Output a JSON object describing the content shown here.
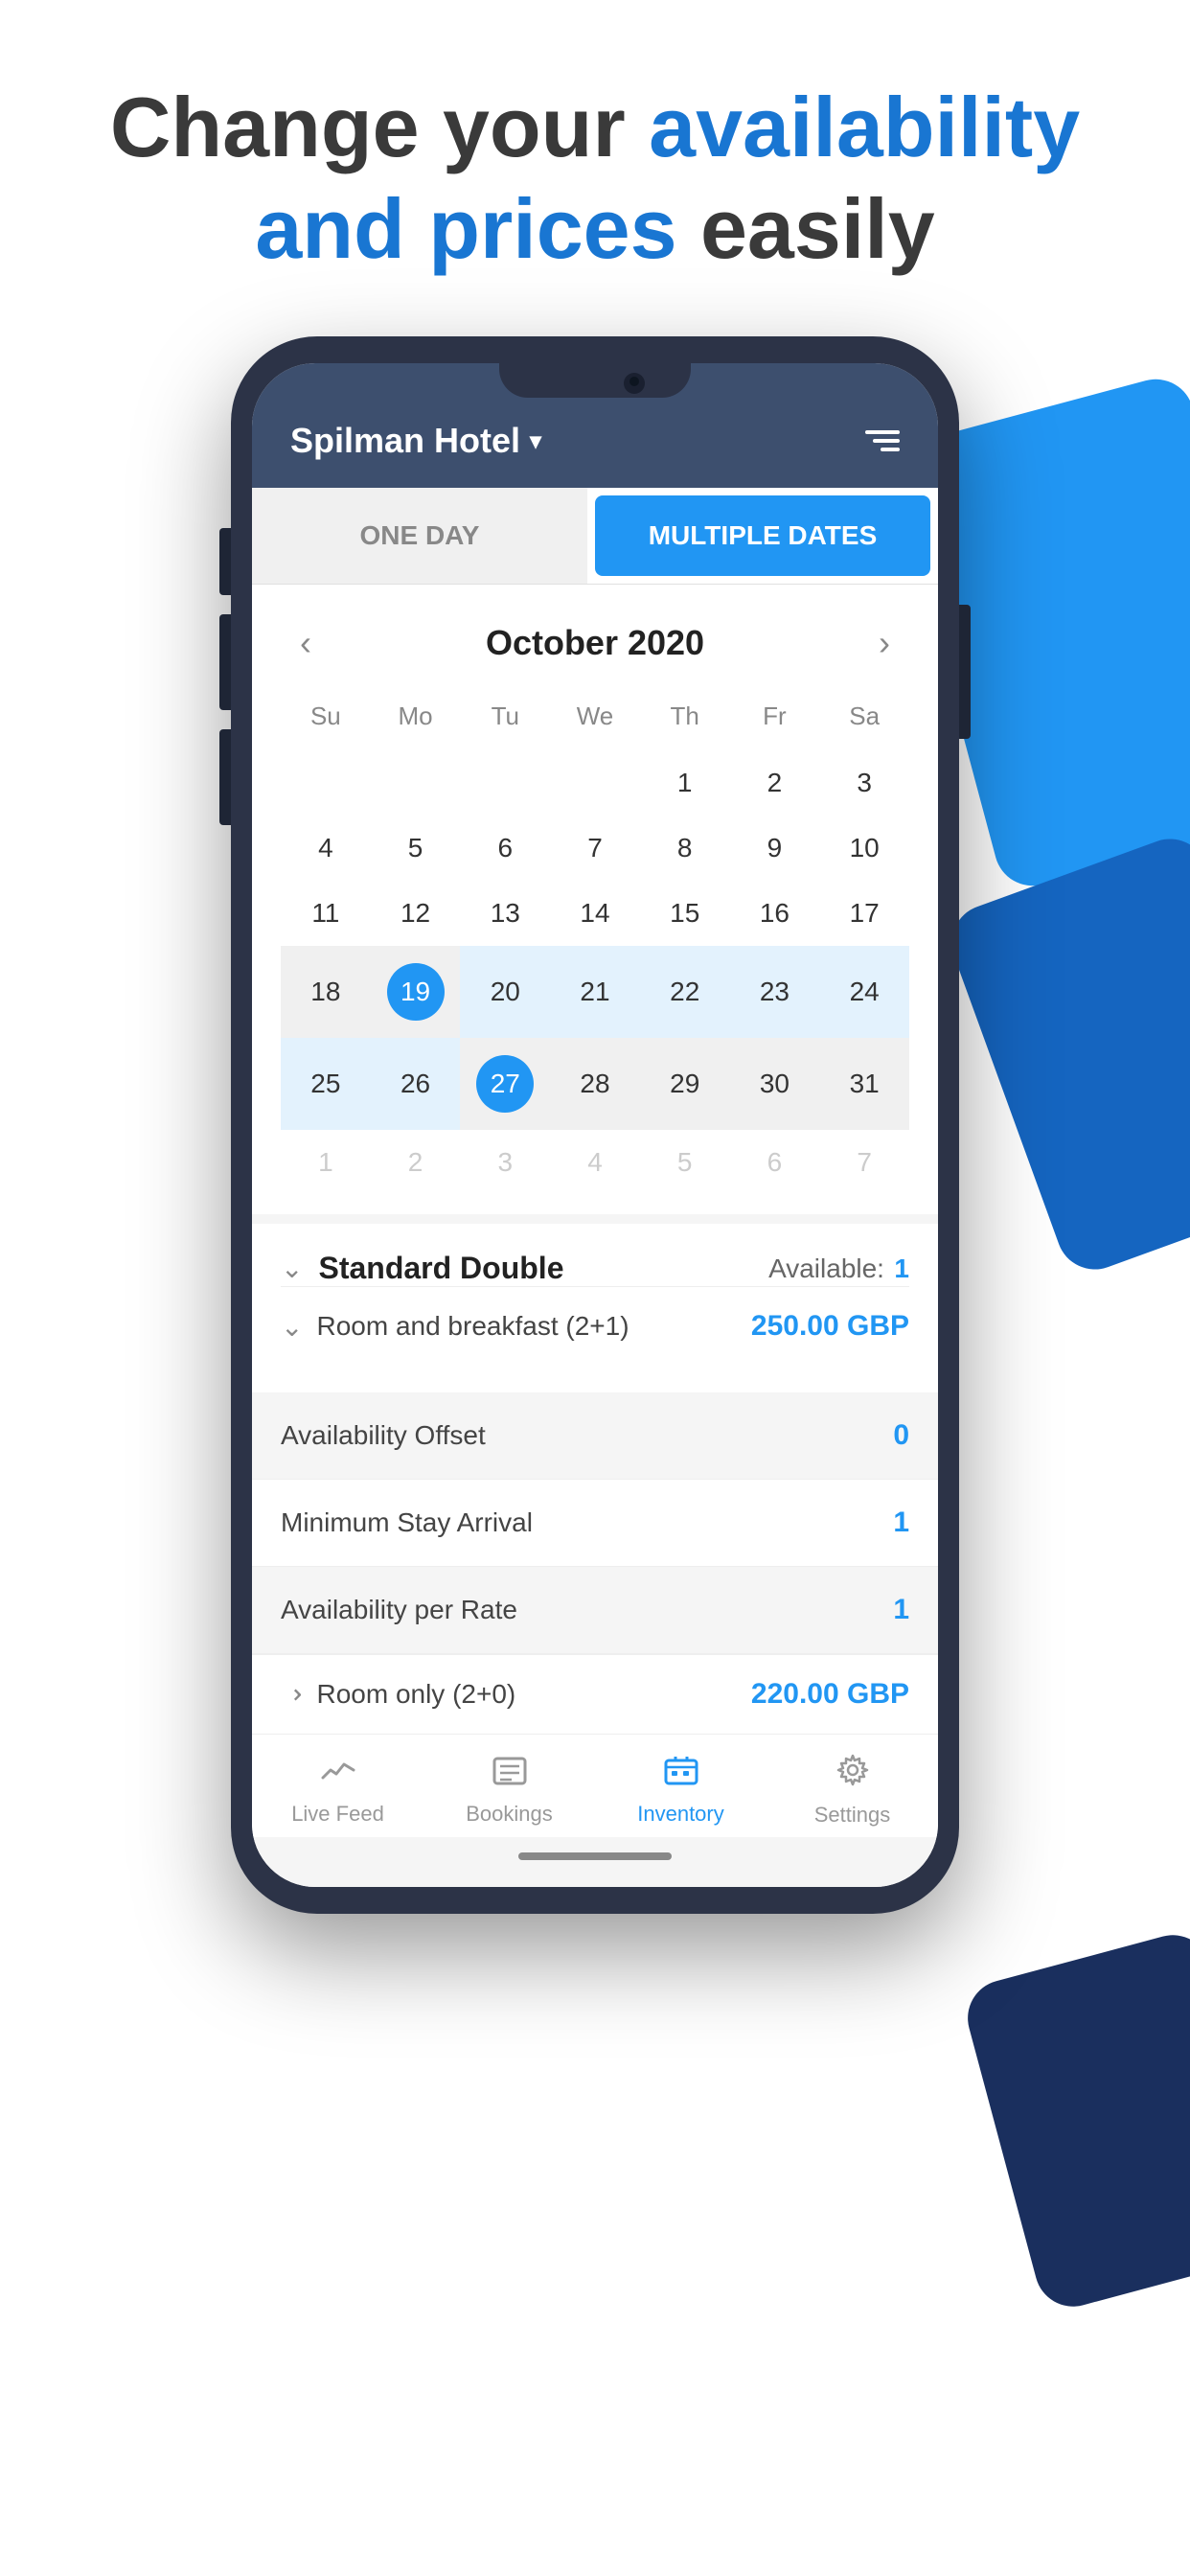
{
  "header": {
    "line1": "Change your ",
    "highlight1": "availability",
    "line2": "and prices",
    "line2_plain": " easily"
  },
  "app": {
    "hotel_name": "Spilman Hotel",
    "tabs": [
      {
        "label": "ONE DAY",
        "active": false
      },
      {
        "label": "MULTIPLE DATES",
        "active": true
      }
    ],
    "calendar": {
      "month": "October 2020",
      "prev_arrow": "‹",
      "next_arrow": "›",
      "day_headers": [
        "Su",
        "Mo",
        "Tu",
        "We",
        "Th",
        "Fr",
        "Sa"
      ],
      "weeks": [
        [
          {
            "day": "",
            "type": "empty"
          },
          {
            "day": "",
            "type": "empty"
          },
          {
            "day": "",
            "type": "empty"
          },
          {
            "day": "",
            "type": "empty"
          },
          {
            "day": "1",
            "type": "normal"
          },
          {
            "day": "2",
            "type": "normal"
          },
          {
            "day": "3",
            "type": "normal"
          }
        ],
        [
          {
            "day": "4",
            "type": "normal"
          },
          {
            "day": "5",
            "type": "normal"
          },
          {
            "day": "6",
            "type": "normal"
          },
          {
            "day": "7",
            "type": "normal"
          },
          {
            "day": "8",
            "type": "normal"
          },
          {
            "day": "9",
            "type": "normal"
          },
          {
            "day": "10",
            "type": "normal"
          }
        ],
        [
          {
            "day": "11",
            "type": "normal"
          },
          {
            "day": "12",
            "type": "normal"
          },
          {
            "day": "13",
            "type": "normal"
          },
          {
            "day": "14",
            "type": "normal"
          },
          {
            "day": "15",
            "type": "normal"
          },
          {
            "day": "16",
            "type": "normal"
          },
          {
            "day": "17",
            "type": "normal"
          }
        ],
        [
          {
            "day": "18",
            "type": "normal"
          },
          {
            "day": "19",
            "type": "selected-start"
          },
          {
            "day": "20",
            "type": "range"
          },
          {
            "day": "21",
            "type": "range"
          },
          {
            "day": "22",
            "type": "range"
          },
          {
            "day": "23",
            "type": "range"
          },
          {
            "day": "24",
            "type": "range"
          }
        ],
        [
          {
            "day": "25",
            "type": "range"
          },
          {
            "day": "26",
            "type": "range"
          },
          {
            "day": "27",
            "type": "selected-end"
          },
          {
            "day": "28",
            "type": "normal"
          },
          {
            "day": "29",
            "type": "normal"
          },
          {
            "day": "30",
            "type": "normal"
          },
          {
            "day": "31",
            "type": "normal"
          }
        ],
        [
          {
            "day": "1",
            "type": "other-month"
          },
          {
            "day": "2",
            "type": "other-month"
          },
          {
            "day": "3",
            "type": "other-month"
          },
          {
            "day": "4",
            "type": "other-month"
          },
          {
            "day": "5",
            "type": "other-month"
          },
          {
            "day": "6",
            "type": "other-month"
          },
          {
            "day": "7",
            "type": "other-month"
          }
        ]
      ]
    },
    "room": {
      "name": "Standard Double",
      "available_label": "Available:",
      "available_count": "1",
      "rates": [
        {
          "name": "Room and breakfast (2+1)",
          "price": "250.00 GBP",
          "expanded": true
        }
      ],
      "info_rows": [
        {
          "label": "Availability Offset",
          "value": "0"
        },
        {
          "label": "Minimum Stay Arrival",
          "value": "1"
        },
        {
          "label": "Availability per Rate",
          "value": "1"
        }
      ],
      "more_rates": [
        {
          "name": "Room only (2+0)",
          "price": "220.00 GBP",
          "expanded": false
        }
      ]
    },
    "bottom_nav": [
      {
        "label": "Live Feed",
        "icon": "📈",
        "active": false
      },
      {
        "label": "Bookings",
        "icon": "≡",
        "active": false
      },
      {
        "label": "Inventory",
        "icon": "📅",
        "active": true
      },
      {
        "label": "Settings",
        "icon": "⚙",
        "active": false
      }
    ]
  }
}
